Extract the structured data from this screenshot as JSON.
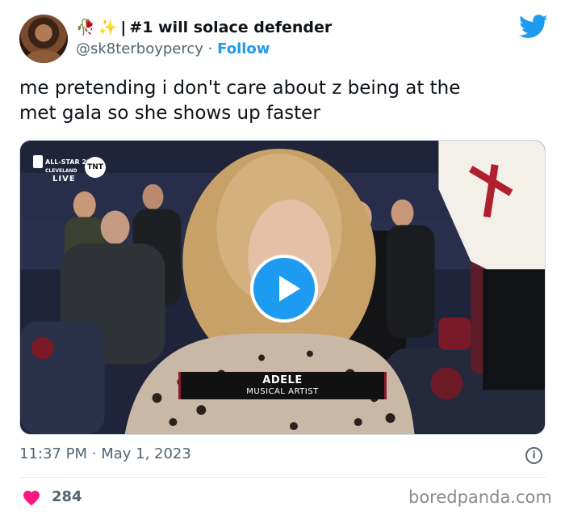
{
  "user": {
    "emoji_1": "🥀",
    "emoji_2": "✨",
    "separator": "|",
    "display_name": "#1 will solace defender",
    "handle": "@sk8terboypercy",
    "dot": "·",
    "follow_label": "Follow"
  },
  "tweet": {
    "line_1": "me pretending i don't care about z being at the",
    "line_2": "met gala so she shows up faster"
  },
  "media": {
    "broadcast": {
      "event": "ALL-STAR 2022",
      "city": "CLEVELAND",
      "network": "TNT",
      "live_label": "LIVE"
    },
    "lower_third": {
      "name": "ADELE",
      "title": "MUSICAL ARTIST"
    }
  },
  "meta": {
    "time": "11:37 PM",
    "dot": "·",
    "date": "May 1, 2023",
    "info_glyph": "i"
  },
  "engagement": {
    "likes": "284"
  },
  "watermark": "boredpanda.com",
  "icons": {
    "avatar": "avatar",
    "brand": "twitter-bird-icon",
    "play": "play-icon",
    "info": "info-icon",
    "like": "heart-icon"
  },
  "colors": {
    "accent": "#1d9bf0",
    "text": "#0f1419",
    "muted": "#536471",
    "heart": "#f91880"
  }
}
